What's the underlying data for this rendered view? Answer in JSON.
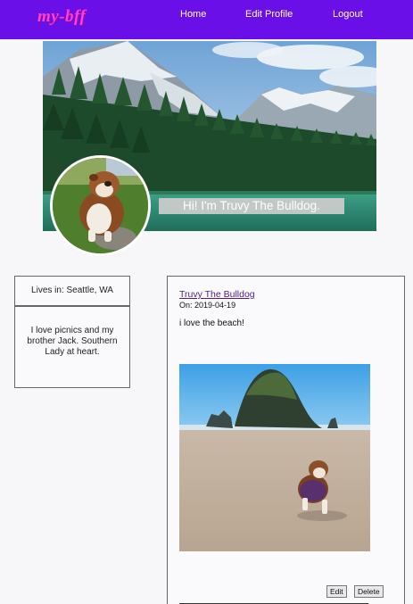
{
  "navbar": {
    "logo": "my-bff",
    "links": [
      "Home",
      "Edit Profile",
      "Logout"
    ],
    "background": "#6a0fe8",
    "logo_color": "#ff3fd6"
  },
  "profile": {
    "greeting": "Hi! I'm Truvy The Bulldog.",
    "location": "Lives in: Seattle, WA",
    "bio": "I love picnics and my brother Jack. Southern Lady at heart."
  },
  "post": {
    "author": "Truvy The Bulldog",
    "date_prefix": "On:",
    "date": "2019-04-19",
    "body": "i love the beach!",
    "edit_label": "Edit",
    "delete_label": "Delete"
  }
}
